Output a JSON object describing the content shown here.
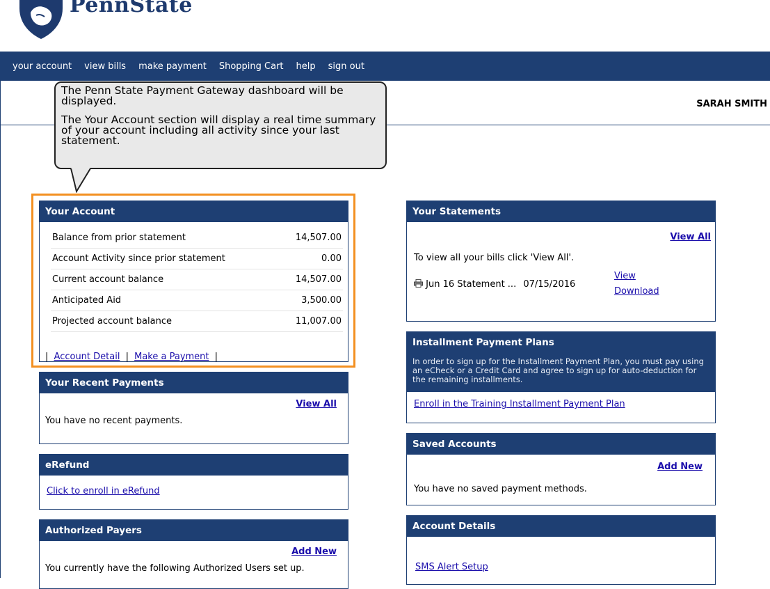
{
  "brand": {
    "name": "PennState"
  },
  "nav": [
    "your account",
    "view bills",
    "make payment",
    "Shopping Cart",
    "help",
    "sign out"
  ],
  "user": {
    "name": "SARAH SMITH"
  },
  "callout": {
    "p1": "The Penn State Payment Gateway dashboard will be displayed.",
    "p2": "The Your Account section will display a real time summary of your account including all activity since your last statement."
  },
  "your_account": {
    "title": "Your Account",
    "rows": [
      {
        "label": "Balance from prior statement",
        "value": "14,507.00"
      },
      {
        "label": "Account Activity since prior statement",
        "value": "0.00"
      },
      {
        "label": "Current account balance",
        "value": "14,507.00"
      },
      {
        "label": "Anticipated Aid",
        "value": "3,500.00"
      },
      {
        "label": "Projected account balance",
        "value": "11,007.00"
      }
    ],
    "sep": "|",
    "link_detail": "Account Detail",
    "link_payment": "Make a Payment"
  },
  "recent_payments": {
    "title": "Your Recent Payments",
    "view_all": "View All",
    "empty": "You have no recent payments."
  },
  "erefund": {
    "title": "eRefund",
    "link": "Click to enroll in eRefund"
  },
  "authorized_payers": {
    "title": "Authorized Payers",
    "add_new": "Add New",
    "text": "You currently have the following Authorized Users set up."
  },
  "statements": {
    "title": "Your Statements",
    "view_all": "View All",
    "text": "To view all your bills click 'View All'.",
    "item_name": "Jun 16 Statement ...",
    "item_date": "07/15/2016",
    "view": "View",
    "download": "Download"
  },
  "installment": {
    "title": "Installment Payment Plans",
    "text": "In order to sign up for the Installment Payment Plan, you must pay using an eCheck or a Credit Card and agree to sign up for auto-deduction for the remaining installments.",
    "link": "Enroll in the Training Installment Payment Plan"
  },
  "saved_accounts": {
    "title": "Saved Accounts",
    "add_new": "Add New",
    "text": "You have no saved payment methods."
  },
  "account_details": {
    "title": "Account Details",
    "link": "SMS Alert Setup"
  },
  "colors": {
    "navy": "#1e3f73",
    "highlight": "#f39021",
    "link": "#1a0dab"
  }
}
